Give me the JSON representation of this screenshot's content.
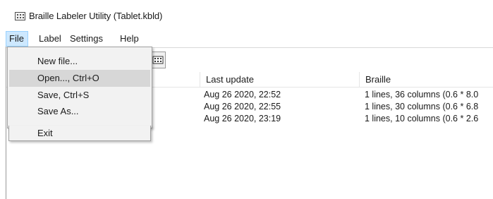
{
  "window": {
    "title": "Braille Labeler Utility (Tablet.kbld)"
  },
  "menubar": {
    "items": [
      {
        "label": "File"
      },
      {
        "label": "Label"
      },
      {
        "label": "Settings"
      },
      {
        "label": "Help"
      }
    ]
  },
  "file_menu": {
    "items": [
      {
        "label": "New file..."
      },
      {
        "label": "Open..., Ctrl+O"
      },
      {
        "label": "Save, Ctrl+S"
      },
      {
        "label": "Save As..."
      },
      {
        "label": "Exit"
      }
    ]
  },
  "toolbar": {
    "icon": "braille-label-icon"
  },
  "list": {
    "columns": [
      "Last update",
      "Braille"
    ],
    "rows": [
      {
        "last_update": "Aug 26 2020, 22:52",
        "braille": "1 lines, 36 columns (0.6 * 8.0"
      },
      {
        "last_update": "Aug 26 2020, 22:55",
        "braille": "1 lines, 30 columns (0.6 * 6.8"
      },
      {
        "last_update": "Aug 26 2020, 23:19",
        "braille": "1 lines, 10 columns (0.6 * 2.6"
      }
    ]
  }
}
